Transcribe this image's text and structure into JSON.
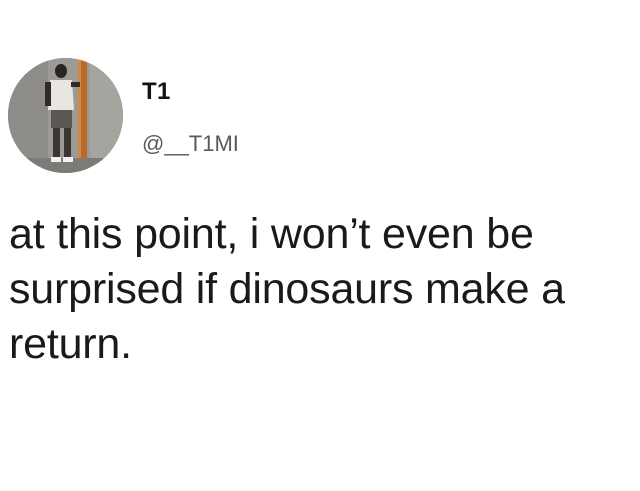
{
  "tweet": {
    "display_name": "T1",
    "handle": "@__T1MI",
    "text": "at this point, i won’t even be surprised if dinosaurs make a return."
  },
  "icons": {
    "avatar": "profile-photo-person-standing"
  },
  "colors": {
    "background": "#ffffff",
    "name": "#141414",
    "handle": "#5a5a5a",
    "text": "#1a1a1a"
  }
}
